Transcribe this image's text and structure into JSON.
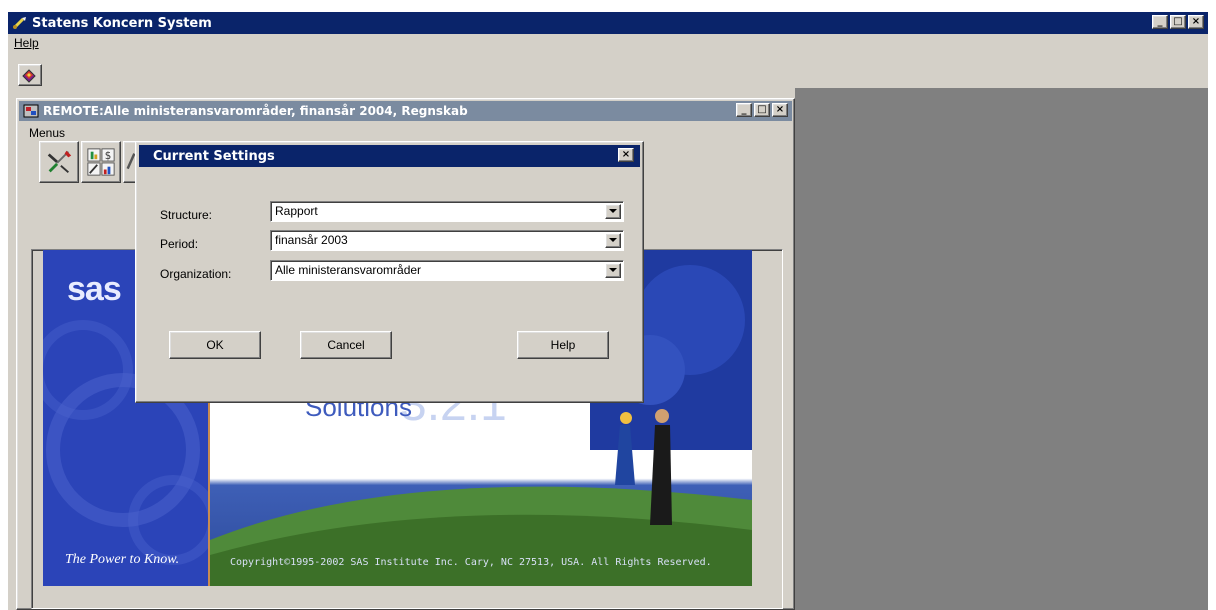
{
  "main_window": {
    "title": "Statens Koncern System",
    "controls": {
      "minimize": "_",
      "maximize": "□",
      "close": "×"
    }
  },
  "menubar": {
    "items": [
      {
        "label": "Help"
      }
    ]
  },
  "toolbar": {
    "icons": [
      "book-icon"
    ]
  },
  "child_window": {
    "title": "REMOTE:Alle ministeransvarområder, finansår 2004, Regnskab",
    "menus_label": "Menus"
  },
  "splash": {
    "logo": "sas",
    "tagline": "The Power to Know.",
    "solutions_text": "Solutions",
    "solutions_version": "3.2.1",
    "copyright": "Copyright©1995-2002 SAS Institute Inc. Cary, NC 27513, USA. All Rights Reserved.",
    "colors": {
      "left_panel": "#2b44b8",
      "accent_line": "#c98c50"
    }
  },
  "dialog": {
    "title": "Current Settings",
    "fields": [
      {
        "label": "Structure:",
        "value": "Rapport"
      },
      {
        "label": "Period:",
        "value": "finansår 2003"
      },
      {
        "label": "Organization:",
        "value": "Alle ministeransvarområder"
      }
    ],
    "buttons": {
      "ok": "OK",
      "cancel": "Cancel",
      "help": "Help"
    }
  },
  "colors": {
    "titlebar_active": "#0a246a",
    "titlebar_inactive": "#7b8ba0",
    "face": "#d4d0c8",
    "workspace": "#808080"
  }
}
